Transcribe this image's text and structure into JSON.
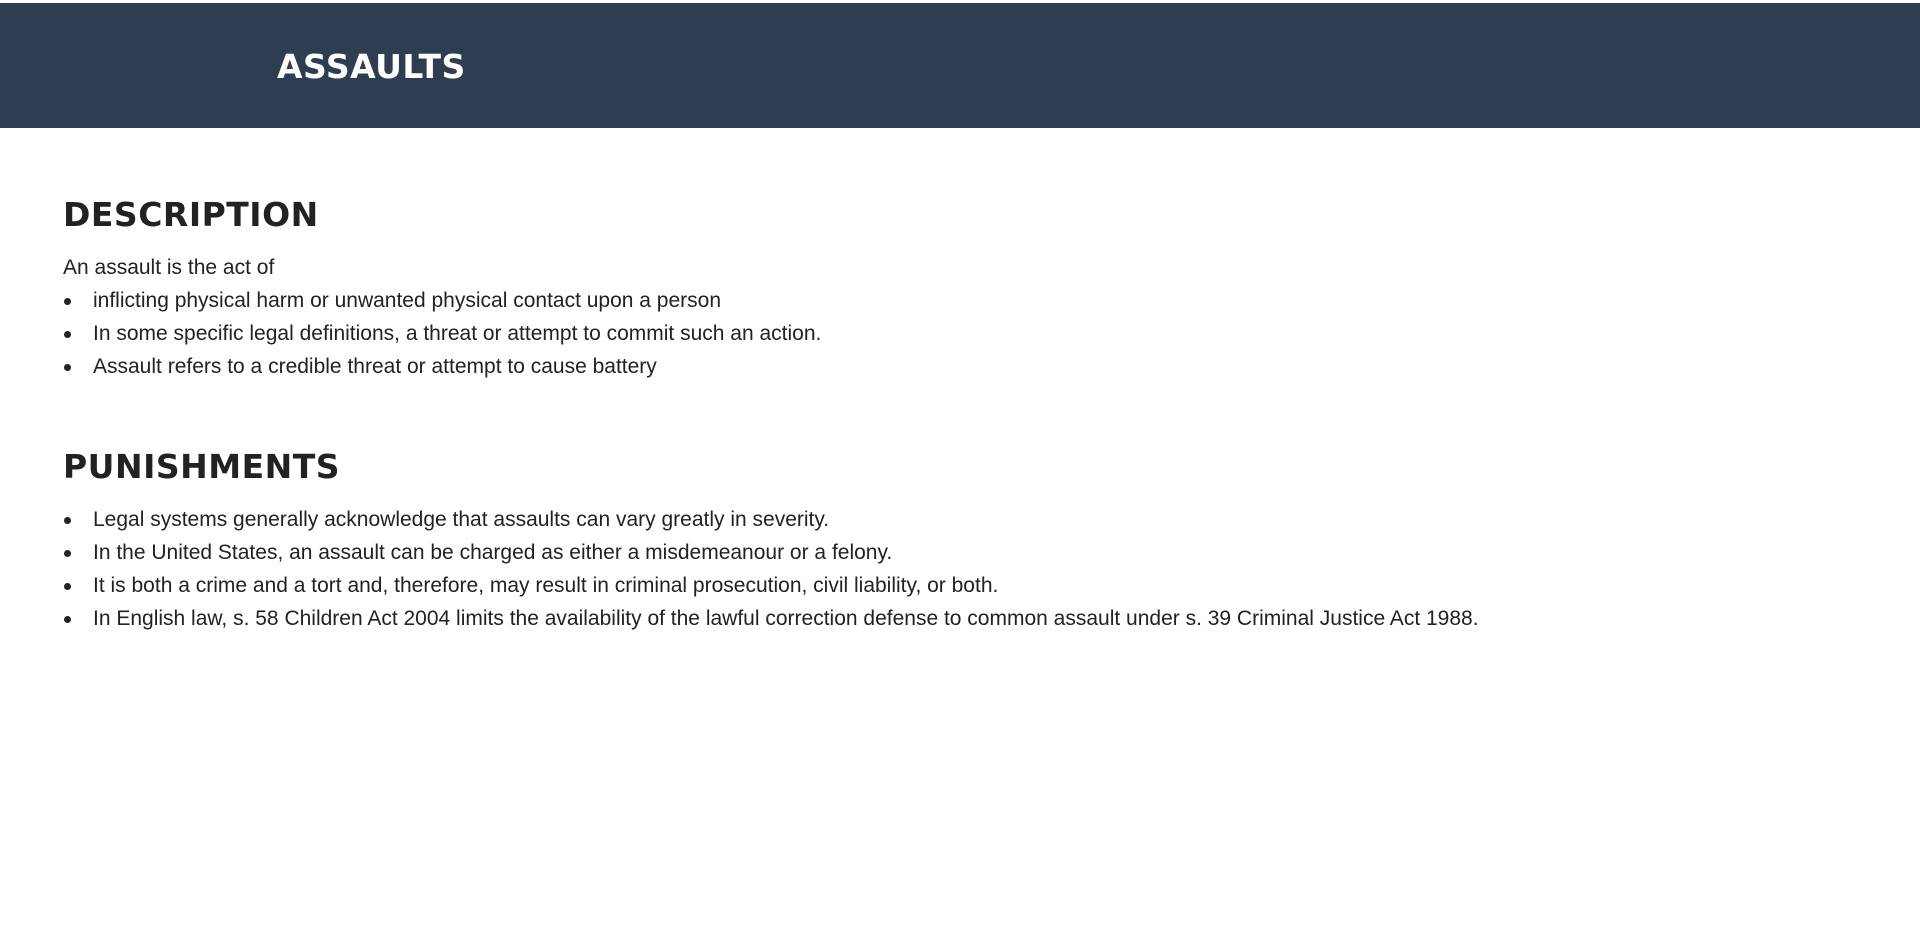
{
  "header": {
    "title": "ASSAULTS",
    "background_color": "#2e3e50"
  },
  "description": {
    "heading": "DESCRIPTION",
    "intro": "An assault is the act of",
    "items": [
      "inflicting physical harm or unwanted physical contact upon a person",
      "In some specific legal definitions, a threat or attempt to commit such an action.",
      "Assault refers to a credible threat or attempt to cause battery"
    ]
  },
  "punishments": {
    "heading": "PUNISHMENTS",
    "items": [
      "Legal systems generally acknowledge that assaults can vary greatly in severity.",
      "In the United States, an assault can be charged as either a misdemeanour or a felony.",
      "It is both a crime and a tort and, therefore, may result in criminal prosecution, civil liability, or both.",
      "In English law, s. 58 Children Act 2004 limits the availability of the lawful correction defense to common assault under s. 39 Criminal Justice Act 1988."
    ]
  }
}
